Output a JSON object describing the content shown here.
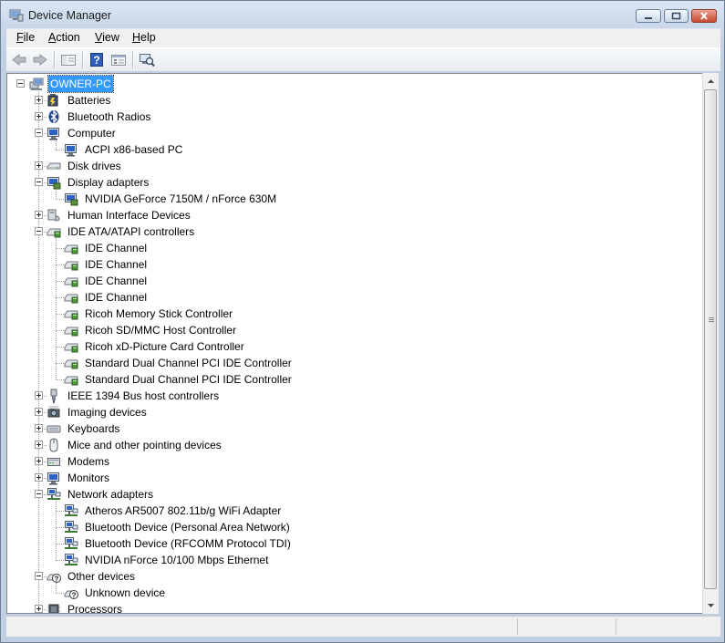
{
  "window": {
    "title": "Device Manager"
  },
  "menu": [
    {
      "label": "File",
      "mnemonic": "F",
      "rest": "ile"
    },
    {
      "label": "Action",
      "mnemonic": "A",
      "rest": "ction"
    },
    {
      "label": "View",
      "mnemonic": "V",
      "rest": "iew"
    },
    {
      "label": "Help",
      "mnemonic": "H",
      "rest": "elp"
    }
  ],
  "toolbar": [
    {
      "icon": "back-arrow-icon"
    },
    {
      "icon": "forward-arrow-icon"
    },
    {
      "icon": "show-hide-console-tree-icon"
    },
    {
      "icon": "help-icon"
    },
    {
      "icon": "properties-icon"
    },
    {
      "icon": "scan-hardware-changes-icon"
    }
  ],
  "tree": [
    {
      "level": 0,
      "label": "OWNER-PC",
      "icon": "computer-icon",
      "exp": "minus",
      "selected": true
    },
    {
      "level": 1,
      "label": "Batteries",
      "icon": "battery-icon",
      "exp": "plus"
    },
    {
      "level": 1,
      "label": "Bluetooth Radios",
      "icon": "bluetooth-icon",
      "exp": "plus"
    },
    {
      "level": 1,
      "label": "Computer",
      "icon": "monitor-icon",
      "exp": "minus"
    },
    {
      "level": 2,
      "label": "ACPI x86-based PC",
      "icon": "monitor-icon"
    },
    {
      "level": 1,
      "label": "Disk drives",
      "icon": "disk-drive-icon",
      "exp": "plus"
    },
    {
      "level": 1,
      "label": "Display adapters",
      "icon": "display-adapter-icon",
      "exp": "minus"
    },
    {
      "level": 2,
      "label": "NVIDIA GeForce 7150M / nForce 630M",
      "icon": "display-adapter-icon"
    },
    {
      "level": 1,
      "label": "Human Interface Devices",
      "icon": "hid-icon",
      "exp": "plus"
    },
    {
      "level": 1,
      "label": "IDE ATA/ATAPI controllers",
      "icon": "controller-icon",
      "exp": "minus"
    },
    {
      "level": 2,
      "label": "IDE Channel",
      "icon": "controller-icon"
    },
    {
      "level": 2,
      "label": "IDE Channel",
      "icon": "controller-icon"
    },
    {
      "level": 2,
      "label": "IDE Channel",
      "icon": "controller-icon"
    },
    {
      "level": 2,
      "label": "IDE Channel",
      "icon": "controller-icon"
    },
    {
      "level": 2,
      "label": "Ricoh Memory Stick Controller",
      "icon": "controller-icon"
    },
    {
      "level": 2,
      "label": "Ricoh SD/MMC Host Controller",
      "icon": "controller-icon"
    },
    {
      "level": 2,
      "label": "Ricoh xD-Picture Card Controller",
      "icon": "controller-icon"
    },
    {
      "level": 2,
      "label": "Standard Dual Channel PCI IDE Controller",
      "icon": "controller-icon"
    },
    {
      "level": 2,
      "label": "Standard Dual Channel PCI IDE Controller",
      "icon": "controller-icon"
    },
    {
      "level": 1,
      "label": "IEEE 1394 Bus host controllers",
      "icon": "firewire-icon",
      "exp": "plus"
    },
    {
      "level": 1,
      "label": "Imaging devices",
      "icon": "camera-icon",
      "exp": "plus"
    },
    {
      "level": 1,
      "label": "Keyboards",
      "icon": "keyboard-icon",
      "exp": "plus"
    },
    {
      "level": 1,
      "label": "Mice and other pointing devices",
      "icon": "mouse-icon",
      "exp": "plus"
    },
    {
      "level": 1,
      "label": "Modems",
      "icon": "modem-icon",
      "exp": "plus"
    },
    {
      "level": 1,
      "label": "Monitors",
      "icon": "monitor-icon",
      "exp": "plus"
    },
    {
      "level": 1,
      "label": "Network adapters",
      "icon": "network-icon",
      "exp": "minus"
    },
    {
      "level": 2,
      "label": "Atheros AR5007 802.11b/g WiFi Adapter",
      "icon": "network-icon"
    },
    {
      "level": 2,
      "label": "Bluetooth Device (Personal Area Network)",
      "icon": "network-icon"
    },
    {
      "level": 2,
      "label": "Bluetooth Device (RFCOMM Protocol TDI)",
      "icon": "network-icon"
    },
    {
      "level": 2,
      "label": "NVIDIA nForce 10/100 Mbps Ethernet",
      "icon": "network-icon"
    },
    {
      "level": 1,
      "label": "Other devices",
      "icon": "unknown-device-icon",
      "exp": "minus"
    },
    {
      "level": 2,
      "label": "Unknown device",
      "icon": "unknown-device-icon"
    },
    {
      "level": 1,
      "label": "Processors",
      "icon": "processor-icon",
      "exp": "plus"
    }
  ],
  "colors": {
    "selection": "#3399ff",
    "close_button": "#c84a30",
    "window_frame": "#c9d8ea"
  }
}
